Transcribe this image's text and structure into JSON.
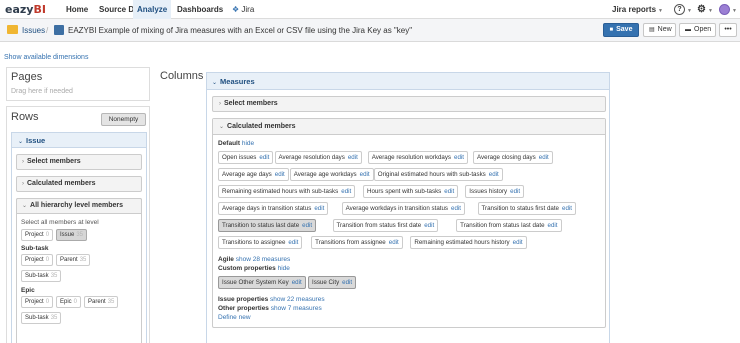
{
  "topnav": {
    "logo_prefix": "ea",
    "logo_mid": "zy",
    "logo_end": "BI",
    "items": [
      {
        "label": "Home"
      },
      {
        "label": "Source Data"
      },
      {
        "label": "Analyze"
      },
      {
        "label": "Dashboards"
      },
      {
        "label": "Jira"
      }
    ],
    "jira_reports": "Jira reports",
    "help_glyph": "?",
    "settings_glyph": "⚙"
  },
  "reportbar": {
    "breadcrumb_root": "Issues",
    "breadcrumb_sep": "/",
    "report_title": "EAZYBI Example of mixing of Jira measures with an Excel or CSV file using the Jira Key as \"key\"",
    "save_label": "Save",
    "new_label": "New",
    "open_label": "Open",
    "more_label": "•••"
  },
  "show_dims": "Show available dimensions",
  "pages": {
    "title": "Pages",
    "hint": "Drag here if needed"
  },
  "rows": {
    "title": "Rows",
    "nonempty": "Nonempty",
    "dimension": "Issue",
    "select_members": "Select members",
    "calculated_members": "Calculated members",
    "all_levels": "All hierarchy level members",
    "select_all_text": "Select all members at level",
    "chips_row1": [
      {
        "label": "Project",
        "n": "0",
        "sel": false
      },
      {
        "label": "Issue",
        "n": "35",
        "sel": true
      }
    ],
    "subtask_heading": "Sub-task",
    "chips_sub": [
      {
        "label": "Project",
        "n": "0"
      },
      {
        "label": "Parent",
        "n": "35"
      }
    ],
    "chips_sub2": [
      {
        "label": "Sub-task",
        "n": "35"
      }
    ],
    "epic_heading": "Epic",
    "chips_epic": [
      {
        "label": "Project",
        "n": "0"
      },
      {
        "label": "Epic",
        "n": "0"
      },
      {
        "label": "Parent",
        "n": "35"
      }
    ],
    "chips_epic2": [
      {
        "label": "Sub-task",
        "n": "35"
      }
    ]
  },
  "columns": {
    "title": "Columns",
    "dimension": "Measures",
    "select_members": "Select members",
    "calculated_members": "Calculated members",
    "default_label": "Default",
    "default_link": "hide",
    "edit_label": "edit",
    "measure_rows": [
      [
        "Open issues",
        "Average resolution days",
        "Average resolution workdays",
        "Average closing days"
      ],
      [
        "Average age days",
        "Average age workdays",
        "Original estimated hours with sub-tasks"
      ],
      [
        "Remaining estimated hours with sub-tasks",
        "Hours spent with sub-tasks",
        "Issues history"
      ],
      [
        "Average days in transition status",
        "Average workdays in transition status",
        "Transition to status first date"
      ],
      [
        "Transition to status last date",
        "Transition from status first date",
        "Transition from status last date"
      ],
      [
        "Transitions to assignee",
        "Transitions from assignee",
        "Remaining estimated hours history"
      ]
    ],
    "selected_measure": "Transition to status last date",
    "agile_label": "Agile",
    "agile_link": "show 28 measures",
    "custom_label": "Custom properties",
    "custom_link": "hide",
    "custom_items": [
      "Issue Other System Key",
      "Issue City"
    ],
    "issue_props_label": "Issue properties",
    "issue_props_link": "show 22 measures",
    "other_props_label": "Other properties",
    "other_props_link": "show 7 measures",
    "define_new": "Define new"
  },
  "colors": {
    "accent": "#3572b0",
    "header_blue_bg": "#e8f0f8",
    "active_nav_bg": "#e6eff8"
  }
}
